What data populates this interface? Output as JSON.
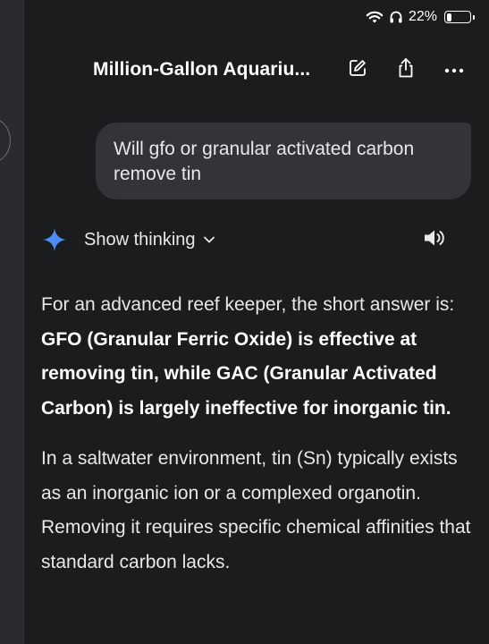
{
  "status_bar": {
    "wifi_icon": "wifi-icon",
    "headphones_icon": "headphones-icon",
    "battery_text": "22%",
    "battery_level": 0.22
  },
  "header": {
    "title": "Million-Gallon Aquariu...",
    "edit_icon": "edit-icon",
    "share_icon": "share-icon",
    "more_icon": "more-icon"
  },
  "user_message": {
    "text": "Will gfo or granular activated carbon remove tin"
  },
  "response": {
    "show_thinking_label": "Show thinking",
    "paragraph1_lead": "For an advanced reef keeper, the short answer is: ",
    "paragraph1_bold": "GFO (Granular Ferric Oxide) is effective at removing tin, while GAC (Granular Activated Carbon) is largely ineffective for inorganic tin.",
    "paragraph2": "In a saltwater environment, tin (Sn) typically exists as an inorganic ion or a complexed organotin. Removing it requires specific chemical affinities that standard carbon lacks."
  },
  "colors": {
    "background": "#1b1c1e",
    "bubble": "#333437",
    "sparkle": "#4c8df6"
  }
}
